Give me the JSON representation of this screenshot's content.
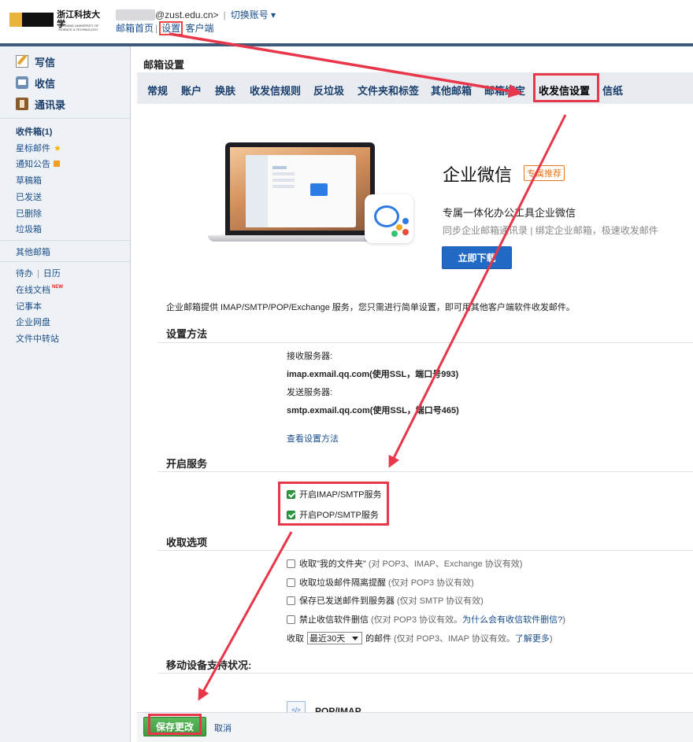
{
  "header": {
    "logo_text": "浙江科技大学",
    "logo_subtext": "ZHEJIANG UNIVERSITY OF SCIENCE & TECHNOLOGY",
    "account_suffix": "@zust.edu.cn>",
    "switch_account": "切换账号 ▾",
    "links": {
      "home": "邮箱首页",
      "settings": "设置",
      "client": "客户端"
    }
  },
  "sidebar": {
    "compose": "写信",
    "inbox_top": "收信",
    "contacts": "通讯录",
    "folders": [
      "收件箱(1)",
      "星标邮件",
      "通知公告",
      "草稿箱",
      "已发送",
      "已删除",
      "垃圾箱"
    ],
    "other_mailbox": "其他邮箱",
    "todo": "待办",
    "calendar": "日历",
    "online_docs": "在线文档",
    "new_badge": "NEW",
    "notes": "记事本",
    "netdisk": "企业网盘",
    "transfer": "文件中转站"
  },
  "main": {
    "title": "邮箱设置",
    "tabs": [
      "常规",
      "账户",
      "换肤",
      "收发信规则",
      "反垃圾",
      "文件夹和标签",
      "其他邮箱",
      "邮箱绑定",
      "收发信设置",
      "信纸"
    ],
    "active_tab": "收发信设置"
  },
  "promo": {
    "title": "企业微信",
    "badge": "专属推荐",
    "subtitle": "专属一体化办公工具企业微信",
    "desc": "同步企业邮箱通讯录 | 绑定企业邮箱，极速收发邮件",
    "button": "立即下载"
  },
  "intro": "企业邮箱提供 IMAP/SMTP/POP/Exchange 服务，您只需进行简单设置，即可用其他客户端软件收发邮件。",
  "setup": {
    "title": "设置方法",
    "incoming_label": "接收服务器:",
    "incoming_value": "imap.exmail.qq.com(使用SSL，端口号993)",
    "outgoing_label": "发送服务器:",
    "outgoing_value": "smtp.exmail.qq.com(使用SSL，端口号465)",
    "view_link": "查看设置方法"
  },
  "services": {
    "title": "开启服务",
    "imap": "开启IMAP/SMTP服务",
    "pop": "开启POP/SMTP服务"
  },
  "receive": {
    "title": "收取选项",
    "options": [
      {
        "label": "收取\"我的文件夹\"",
        "note": "(对 POP3、IMAP、Exchange 协议有效)"
      },
      {
        "label": "收取垃圾邮件隔离提醒",
        "note": "(仅对 POP3 协议有效)"
      },
      {
        "label": "保存已发送邮件到服务器",
        "note": "(仅对 SMTP 协议有效)"
      },
      {
        "label": "禁止收信软件删信",
        "note": "(仅对 POP3 协议有效。",
        "link": "为什么会有收信软件删信?",
        "tail": ")"
      }
    ],
    "period_prefix": "收取",
    "period_value": "最近30天",
    "period_suffix": "的邮件",
    "period_note": "(仅对 POP3、IMAP 协议有效。",
    "period_link": "了解更多",
    "period_tail": ")"
  },
  "mobile": {
    "title": "移动设备支持状况:",
    "icon_glyph": "</>",
    "item": "POP/IMAP"
  },
  "footer": {
    "save": "保存更改",
    "cancel": "取消"
  },
  "annotation_color": "#e8364a"
}
